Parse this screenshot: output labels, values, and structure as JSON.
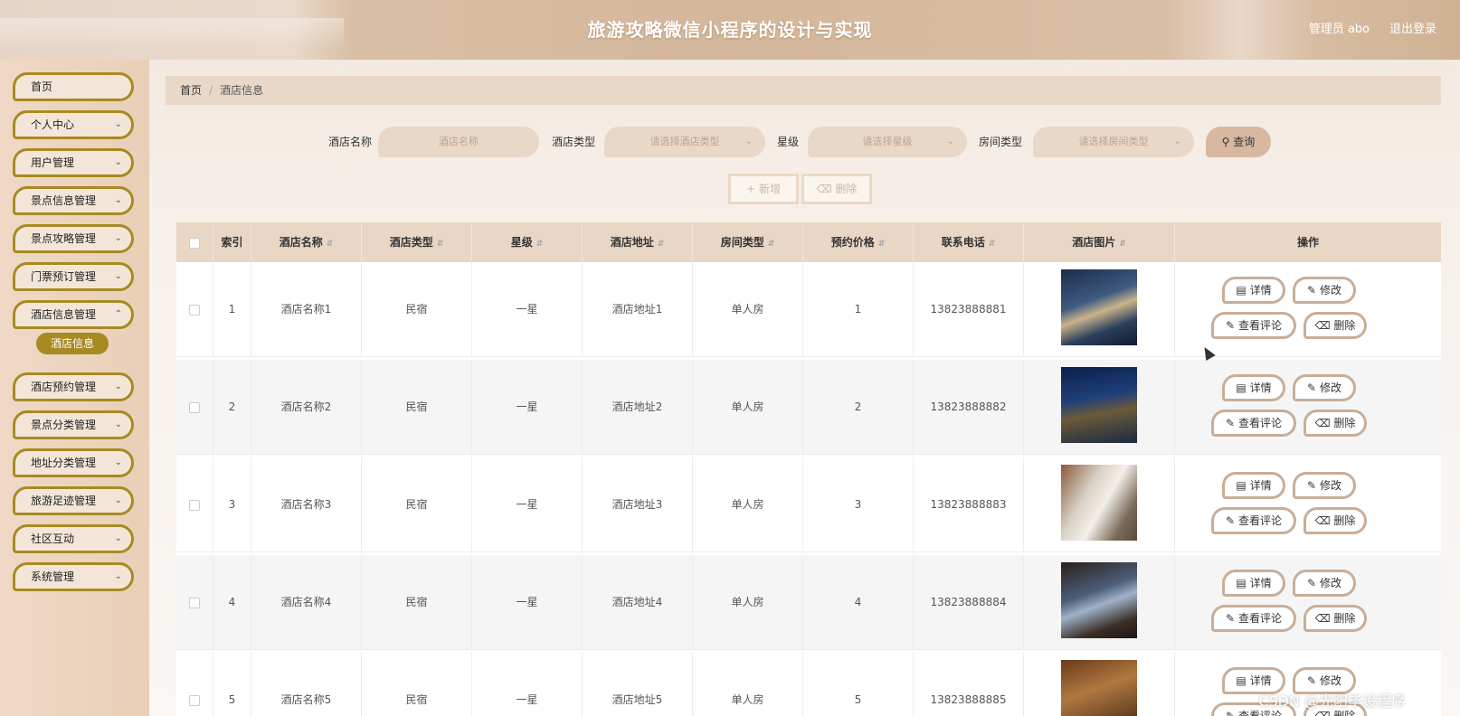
{
  "header": {
    "title": "旅游攻略微信小程序的设计与实现",
    "user": "管理员 abo",
    "logout": "退出登录"
  },
  "sidebar": {
    "items": [
      {
        "label": "首页",
        "chevron": false
      },
      {
        "label": "个人中心",
        "chevron": true
      },
      {
        "label": "用户管理",
        "chevron": true
      },
      {
        "label": "景点信息管理",
        "chevron": true
      },
      {
        "label": "景点攻略管理",
        "chevron": true
      },
      {
        "label": "门票预订管理",
        "chevron": true
      },
      {
        "label": "酒店信息管理",
        "chevron": true
      },
      {
        "label": "酒店预约管理",
        "chevron": true
      },
      {
        "label": "景点分类管理",
        "chevron": true
      },
      {
        "label": "地址分类管理",
        "chevron": true
      },
      {
        "label": "旅游足迹管理",
        "chevron": true
      },
      {
        "label": "社区互动",
        "chevron": true
      },
      {
        "label": "系统管理",
        "chevron": true
      }
    ],
    "active_sub": "酒店信息"
  },
  "breadcrumb": {
    "home": "首页",
    "sep": "/",
    "current": "酒店信息"
  },
  "filters": {
    "name_label": "酒店名称",
    "name_placeholder": "酒店名称",
    "type_label": "酒店类型",
    "type_placeholder": "请选择酒店类型",
    "star_label": "星级",
    "star_placeholder": "请选择星级",
    "room_label": "房间类型",
    "room_placeholder": "请选择房间类型",
    "search": "查询"
  },
  "actions": {
    "add": "新增",
    "delete": "删除"
  },
  "table": {
    "headers": [
      "索引",
      "酒店名称",
      "酒店类型",
      "星级",
      "酒店地址",
      "房间类型",
      "预约价格",
      "联系电话",
      "酒店图片",
      "操作"
    ],
    "row_actions": {
      "detail": "详情",
      "edit": "修改",
      "review": "查看评论",
      "delete": "删除"
    },
    "rows": [
      {
        "index": "1",
        "name": "酒店名称1",
        "type": "民宿",
        "star": "一星",
        "address": "酒店地址1",
        "room": "单人房",
        "price": "1",
        "phone": "13823888881"
      },
      {
        "index": "2",
        "name": "酒店名称2",
        "type": "民宿",
        "star": "一星",
        "address": "酒店地址2",
        "room": "单人房",
        "price": "2",
        "phone": "13823888882"
      },
      {
        "index": "3",
        "name": "酒店名称3",
        "type": "民宿",
        "star": "一星",
        "address": "酒店地址3",
        "room": "单人房",
        "price": "3",
        "phone": "13823888883"
      },
      {
        "index": "4",
        "name": "酒店名称4",
        "type": "民宿",
        "star": "一星",
        "address": "酒店地址4",
        "room": "单人房",
        "price": "4",
        "phone": "13823888884"
      },
      {
        "index": "5",
        "name": "酒店名称5",
        "type": "民宿",
        "star": "一星",
        "address": "酒店地址5",
        "room": "单人房",
        "price": "5",
        "phone": "13823888885"
      }
    ]
  },
  "watermark": "CSDN @光阳毕设程序",
  "colors": {
    "accent": "#a88a23",
    "header": "#d4b79b",
    "table_head": "#e9d6c4"
  }
}
